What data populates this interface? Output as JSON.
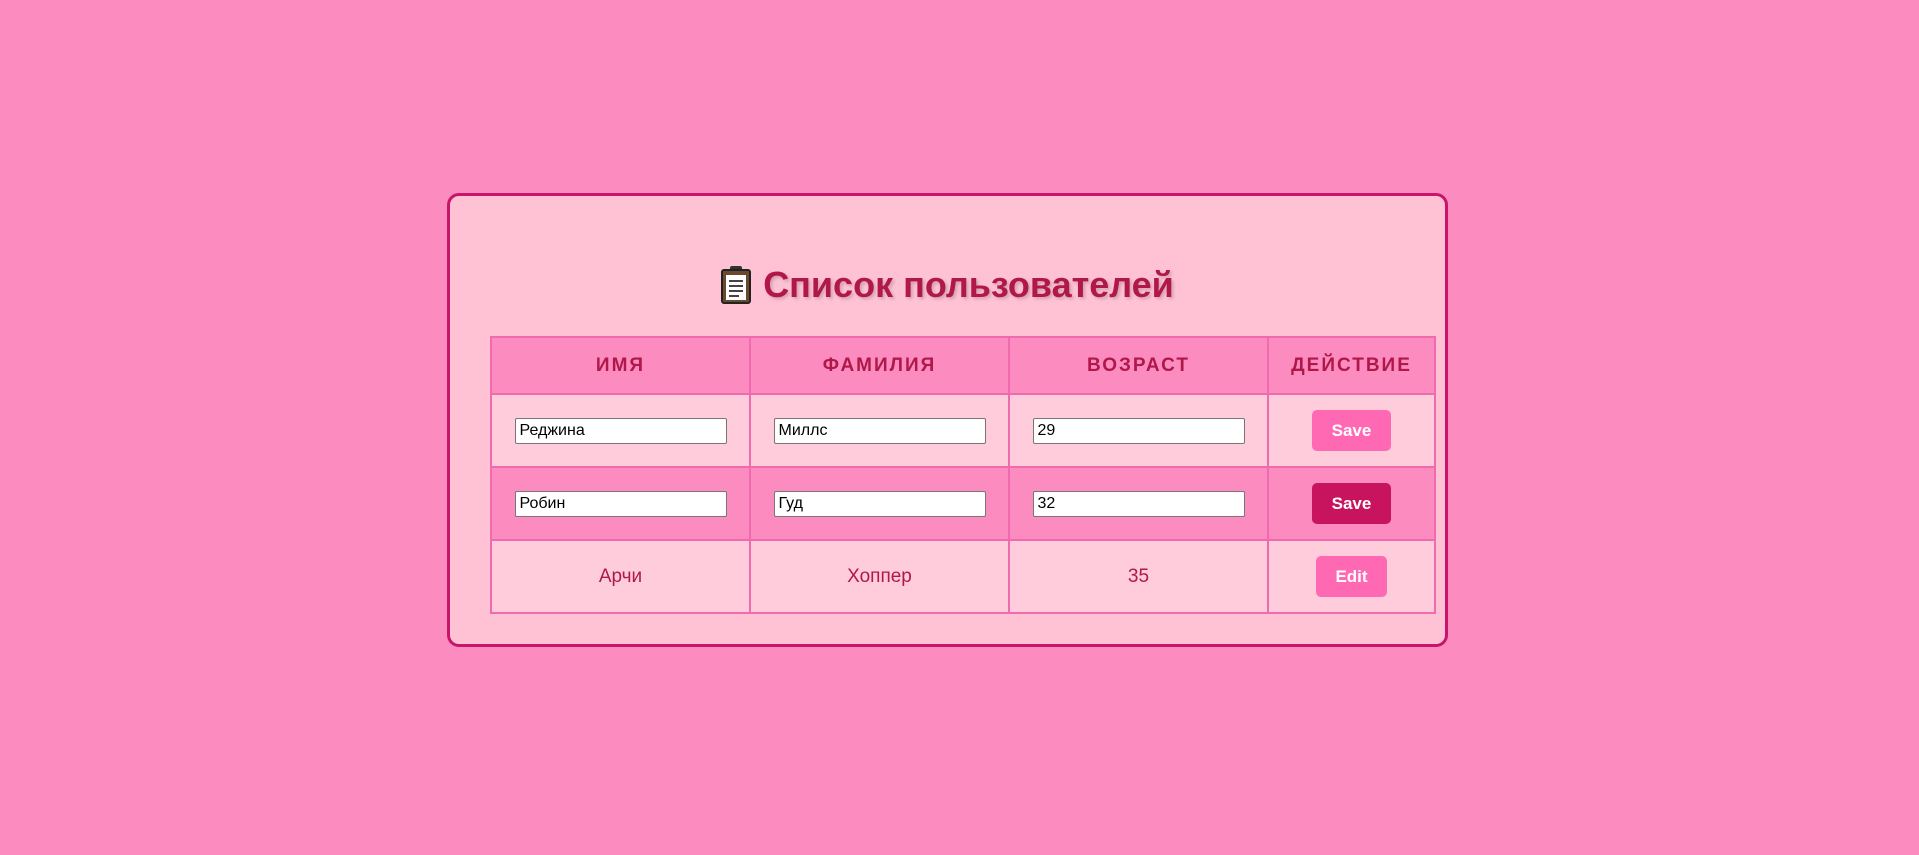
{
  "title": "Список пользователей",
  "title_icon": "clipboard-icon",
  "table": {
    "headers": [
      "ИМЯ",
      "ФАМИЛИЯ",
      "ВОЗРАСТ",
      "ДЕЙСТВИЕ"
    ],
    "rows": [
      {
        "mode": "edit",
        "first_name": "Реджина",
        "last_name": "Миллс",
        "age": "29",
        "action": "Save"
      },
      {
        "mode": "edit",
        "first_name": "Робин",
        "last_name": "Гуд",
        "age": "32",
        "action": "Save"
      },
      {
        "mode": "view",
        "first_name": "Арчи",
        "last_name": "Хоппер",
        "age": "35",
        "action": "Edit"
      }
    ]
  },
  "colors": {
    "background": "#fc8bbf",
    "card": "#ffc2d4",
    "accent": "#c8146a",
    "button": "#ff69b4",
    "button_active": "#c8145e",
    "heading_text": "#b0184a"
  }
}
